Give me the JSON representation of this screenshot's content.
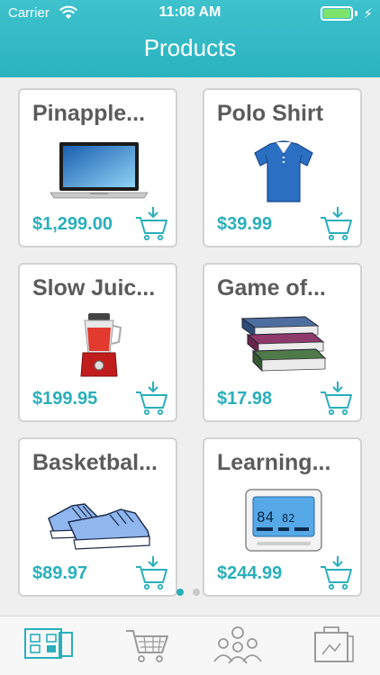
{
  "status_bar": {
    "carrier": "Carrier",
    "time": "11:08 AM",
    "charge_glyph": "⚡"
  },
  "nav": {
    "title": "Products"
  },
  "products": [
    {
      "name": "Pinapple...",
      "price": "$1,299.00",
      "image": "laptop"
    },
    {
      "name": "Polo Shirt",
      "price": "$39.99",
      "image": "polo-shirt"
    },
    {
      "name": "Slow Juic...",
      "price": "$199.95",
      "image": "juicer"
    },
    {
      "name": "Game of...",
      "price": "$17.98",
      "image": "books"
    },
    {
      "name": "Basketbal...",
      "price": "$89.97",
      "image": "sneakers"
    },
    {
      "name": "Learning...",
      "price": "$244.99",
      "image": "thermostat"
    }
  ],
  "thermostat_readout": {
    "current": "84",
    "set": "82"
  },
  "page_indicator": {
    "pages": 2,
    "current": 1
  },
  "tab_bar": {
    "tabs": [
      {
        "icon": "product-grid-icon",
        "active": true
      },
      {
        "icon": "cart-icon",
        "active": false
      },
      {
        "icon": "people-icon",
        "active": false
      },
      {
        "icon": "shopping-bag-icon",
        "active": false
      }
    ]
  },
  "colors": {
    "accent": "#2ab3bf",
    "price": "#29afbc",
    "name": "#5b5b5b",
    "tab_inactive": "#9a9a9a"
  }
}
